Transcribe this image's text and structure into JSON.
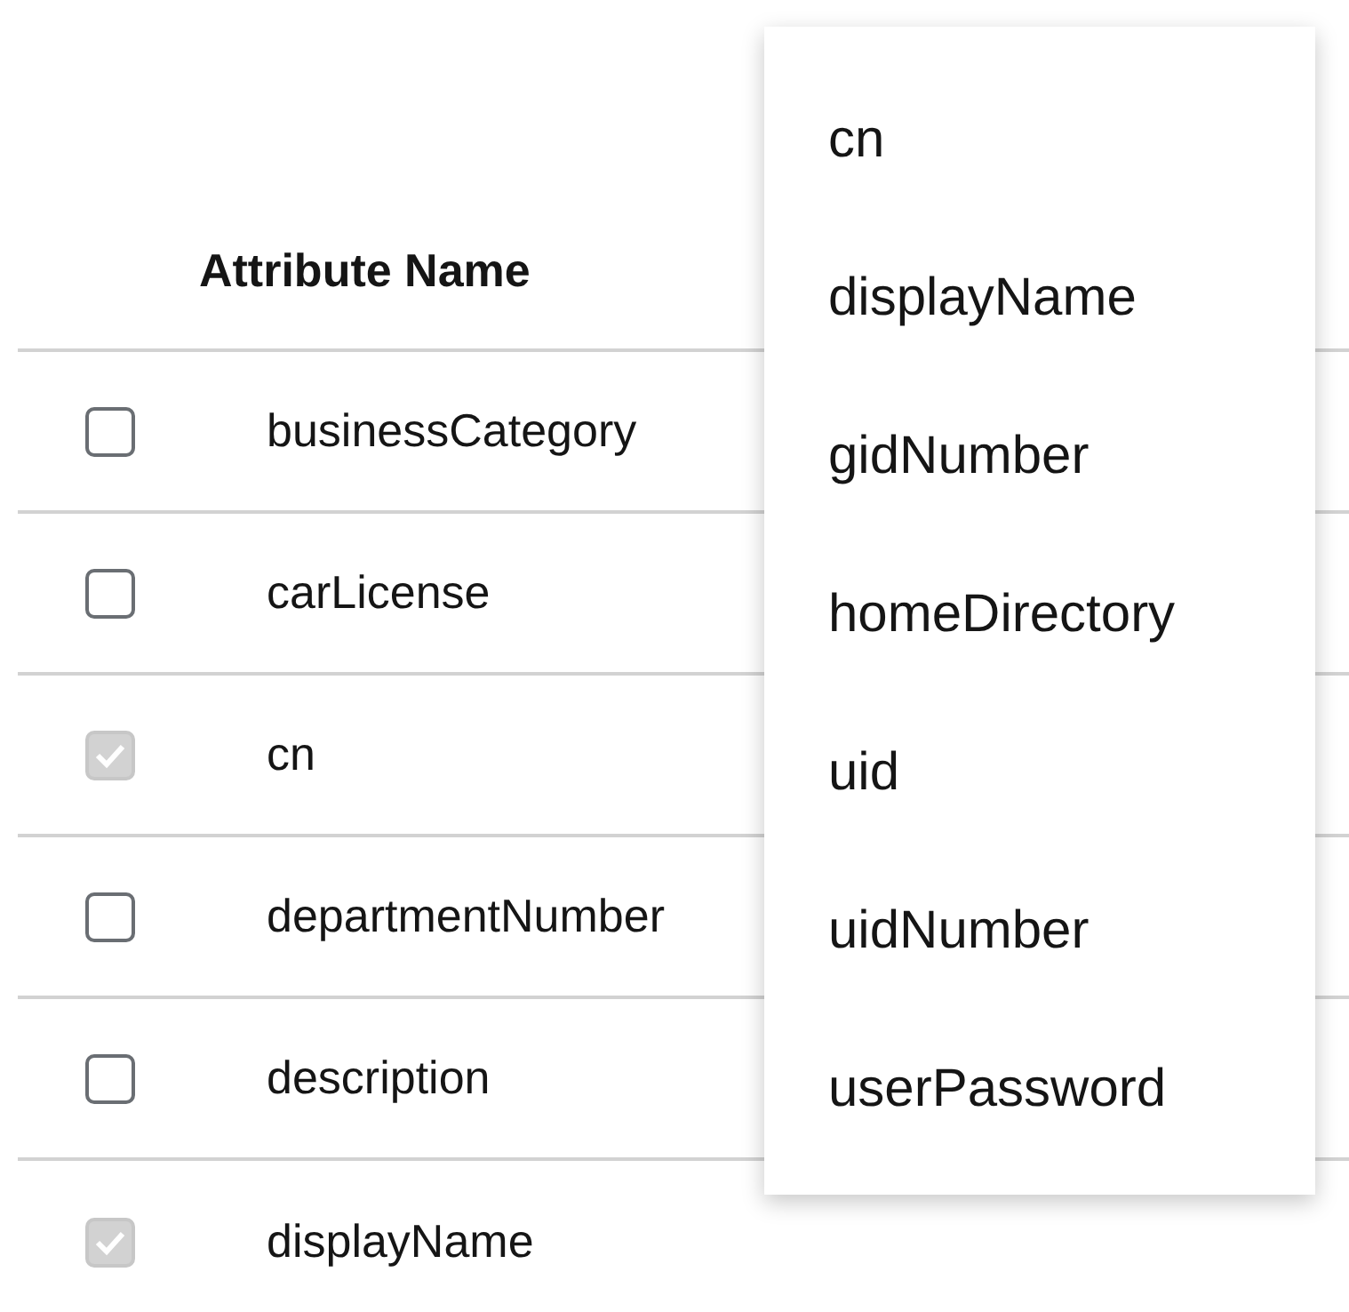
{
  "table": {
    "columns": [
      "Attribute Name"
    ],
    "rows": [
      {
        "name": "businessCategory",
        "checked": false,
        "disabled": false
      },
      {
        "name": "carLicense",
        "checked": false,
        "disabled": false
      },
      {
        "name": "cn",
        "checked": true,
        "disabled": true
      },
      {
        "name": "departmentNumber",
        "checked": false,
        "disabled": false
      },
      {
        "name": "description",
        "checked": false,
        "disabled": false
      },
      {
        "name": "displayName",
        "checked": true,
        "disabled": true
      }
    ]
  },
  "menu": {
    "items": [
      "cn",
      "displayName",
      "gidNumber",
      "homeDirectory",
      "uid",
      "uidNumber",
      "userPassword"
    ]
  }
}
